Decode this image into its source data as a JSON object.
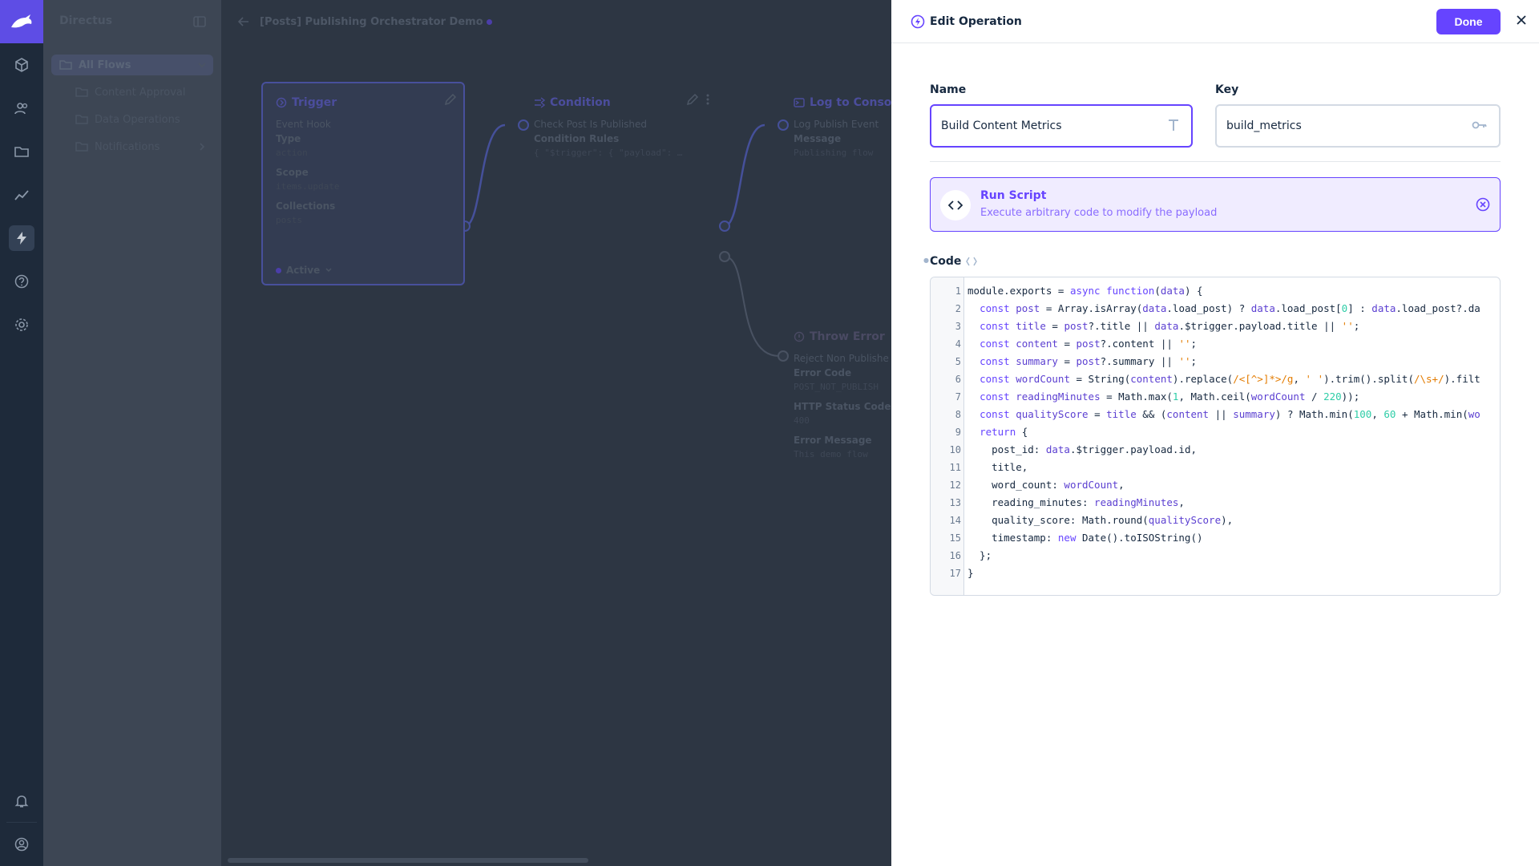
{
  "app": {
    "name": "Directus"
  },
  "breadcrumb": {
    "title": "[Posts] Publishing Orchestrator Demo"
  },
  "nav": {
    "items": [
      {
        "label": "All Flows"
      },
      {
        "label": "Content Approval"
      },
      {
        "label": "Data Operations"
      },
      {
        "label": "Notifications"
      }
    ]
  },
  "flow": {
    "trigger": {
      "title": "Trigger",
      "subtitle": "Event Hook",
      "fields": [
        {
          "label": "Type",
          "value": "action"
        },
        {
          "label": "Scope",
          "value": "items.update"
        },
        {
          "label": "Collections",
          "value": "posts"
        }
      ],
      "status": "Active"
    },
    "condition": {
      "title": "Condition",
      "subtitle": "Check Post Is Published",
      "fields": [
        {
          "label": "Condition Rules",
          "value": "{ \"$trigger\": { \"payload\": …"
        }
      ]
    },
    "log": {
      "title": "Log to Console",
      "subtitle": "Log Publish Event",
      "fields": [
        {
          "label": "Message",
          "value": "Publishing flow"
        }
      ]
    },
    "error": {
      "title": "Throw Error",
      "subtitle": "Reject Non Publishe",
      "fields": [
        {
          "label": "Error Code",
          "value": "POST_NOT_PUBLISH"
        },
        {
          "label": "HTTP Status Code",
          "value": "400"
        },
        {
          "label": "Error Message",
          "value": "This demo flow"
        }
      ]
    }
  },
  "drawer": {
    "title": "Edit Operation",
    "done_label": "Done",
    "name_label": "Name",
    "name_value": "Build Content Metrics",
    "key_label": "Key",
    "key_value": "build_metrics",
    "operation": {
      "title": "Run Script",
      "description": "Execute arbitrary code to modify the payload"
    },
    "code_label": "Code"
  },
  "colors": {
    "accent": "#6644ff",
    "rail": "#1e2a3a",
    "brand": "#5e4de5"
  },
  "icons": {
    "logo": "directus-rabbit-icon",
    "modules": [
      "box-icon",
      "users-icon",
      "folder-icon",
      "insights-icon",
      "flows-bolt-icon",
      "help-icon",
      "settings-gear-icon",
      "bell-icon",
      "account-icon"
    ]
  }
}
